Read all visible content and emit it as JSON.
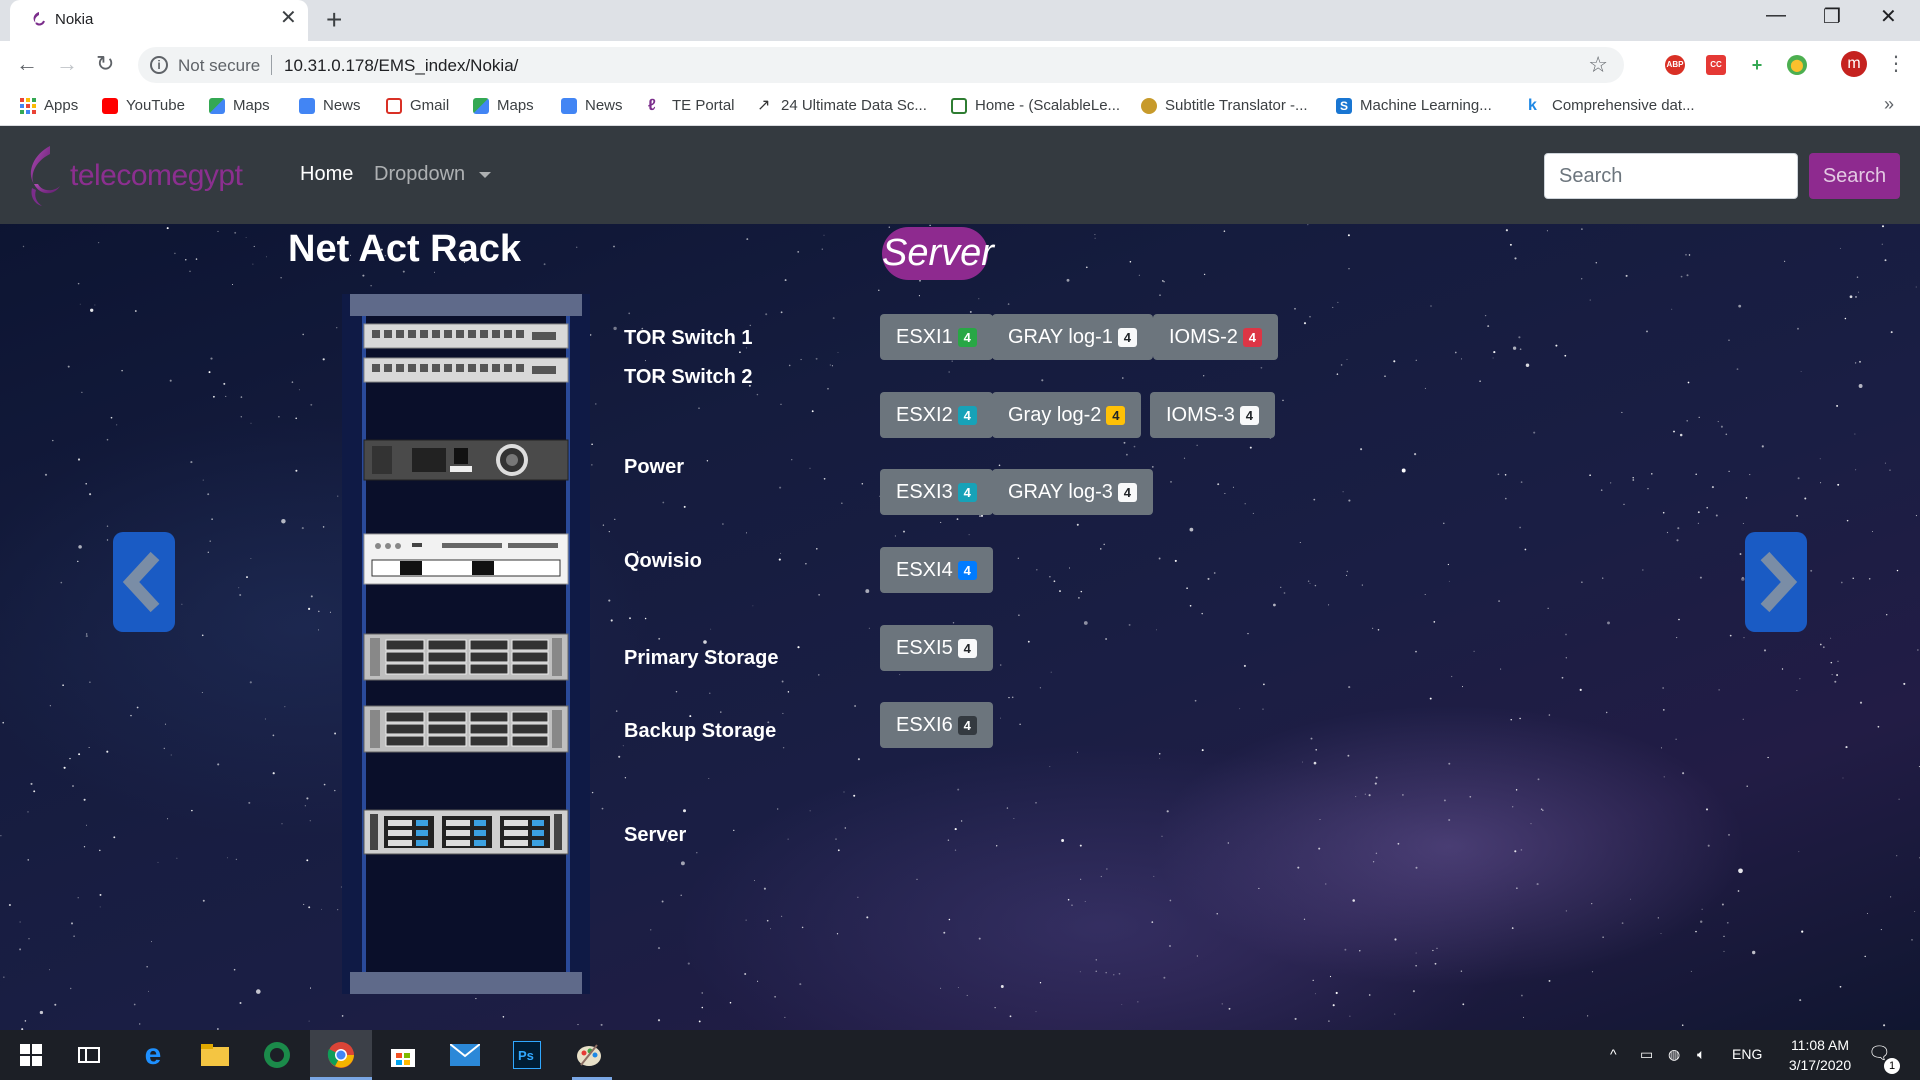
{
  "browser": {
    "tab_title": "Nokia",
    "tab_close": "✕",
    "new_tab": "+",
    "window_controls": [
      "—",
      "❐",
      "✕"
    ],
    "not_secure": "Not secure",
    "url": "10.31.0.178/EMS_index/Nokia/",
    "profile_initial": "m",
    "extensions": [
      "ABP",
      "CC",
      "+",
      "⬤"
    ],
    "bookmarks": [
      {
        "label": "Apps",
        "color": "#e8453c"
      },
      {
        "label": "YouTube",
        "color": "#ff0000"
      },
      {
        "label": "Maps",
        "color": "#34a853"
      },
      {
        "label": "News",
        "color": "#4285f4"
      },
      {
        "label": "Gmail",
        "color": "#d93025"
      },
      {
        "label": "Maps",
        "color": "#34a853"
      },
      {
        "label": "News",
        "color": "#4285f4"
      },
      {
        "label": "TE Portal",
        "color": "#7b2d8b"
      },
      {
        "label": "24 Ultimate Data Sc...",
        "color": "#333333"
      },
      {
        "label": "Home - (ScalableLe...",
        "color": "#2e7d32"
      },
      {
        "label": "Subtitle Translator -...",
        "color": "#c79a2b"
      },
      {
        "label": "Machine Learning...",
        "color": "#1976d2"
      },
      {
        "label": "Comprehensive dat...",
        "color": "#1e88e5"
      }
    ],
    "bookmarks_more": "»"
  },
  "navbar": {
    "brand": "telecomegypt",
    "home": "Home",
    "dropdown": "Dropdown",
    "search_placeholder": "Search",
    "search_button": "Search"
  },
  "content": {
    "heading": "Net Act Rack",
    "section_pill": "Server",
    "rack_labels": [
      {
        "label": "TOR Switch 1"
      },
      {
        "label": "TOR Switch 2"
      },
      {
        "label": "Power"
      },
      {
        "label": "Qowisio"
      },
      {
        "label": "Primary Storage"
      },
      {
        "label": "Backup Storage"
      },
      {
        "label": "Server"
      }
    ],
    "servers": [
      {
        "label": "ESXI1",
        "badge": "4",
        "badge_color": "#28a745"
      },
      {
        "label": "GRAY log-1",
        "badge": "4",
        "badge_color": "#f8f9fa"
      },
      {
        "label": "IOMS-2",
        "badge": "4",
        "badge_color": "#dc3545"
      },
      {
        "label": "ESXI2",
        "badge": "4",
        "badge_color": "#17a2b8"
      },
      {
        "label": "Gray log-2",
        "badge": "4",
        "badge_color": "#ffc107"
      },
      {
        "label": "IOMS-3",
        "badge": "4",
        "badge_color": "#f8f9fa"
      },
      {
        "label": "ESXI3",
        "badge": "4",
        "badge_color": "#17a2b8"
      },
      {
        "label": "GRAY log-3",
        "badge": "4",
        "badge_color": "#f8f9fa"
      },
      {
        "label": "ESXI4",
        "badge": "4",
        "badge_color": "#007bff"
      },
      {
        "label": "ESXI5",
        "badge": "4",
        "badge_color": "#f8f9fa"
      },
      {
        "label": "ESXI6",
        "badge": "4",
        "badge_color": "#343a40"
      }
    ]
  },
  "taskbar": {
    "language": "ENG",
    "time": "11:08 AM",
    "date": "3/17/2020",
    "notification_count": "1"
  }
}
